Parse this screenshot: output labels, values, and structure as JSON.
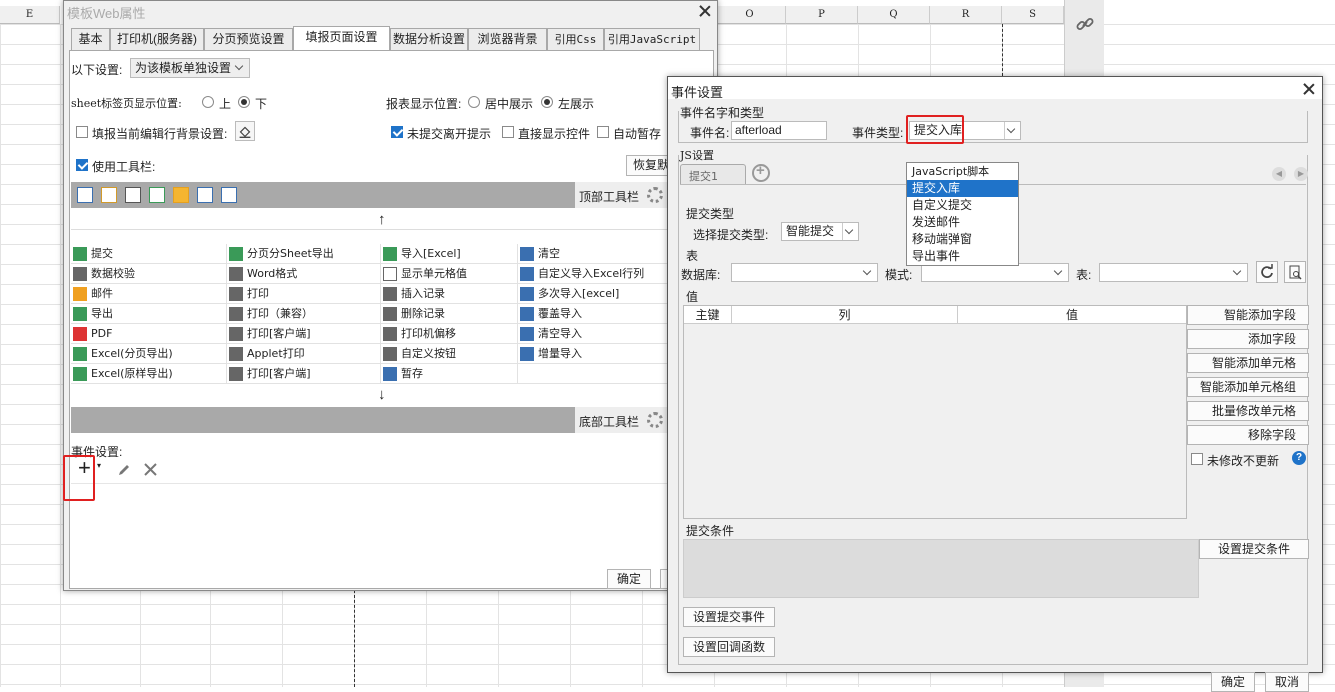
{
  "sheet": {
    "col_labels": [
      "E",
      "O",
      "P",
      "Q",
      "R",
      "S"
    ]
  },
  "web_dialog": {
    "title": "模板Web属性",
    "tabs": [
      "基本",
      "打印机(服务器)",
      "分页预览设置",
      "填报页面设置",
      "数据分析设置",
      "浏览器背景",
      "引用Css",
      "引用JavaScript"
    ],
    "scope_label": "以下设置:",
    "scope_value": "为该模板单独设置",
    "sheet_tab_pos_label": "sheet标签页显示位置:",
    "sheet_tab_up": "上",
    "sheet_tab_down": "下",
    "report_pos_label": "报表显示位置:",
    "report_center": "居中展示",
    "report_left": "左展示",
    "fill_bg_label": "填报当前编辑行背景设置:",
    "unsubmitted_label": "未提交离开提示",
    "direct_show_label": "直接显示控件",
    "auto_save_label": "自动暂存",
    "use_toolbar_label": "使用工具栏:",
    "restore_label": "恢复默",
    "top_toolbar_label": "顶部工具栏",
    "bottom_toolbar_label": "底部工具栏",
    "buttons": [
      [
        "提交",
        "分页分Sheet导出",
        "导入[Excel]",
        "清空"
      ],
      [
        "数据校验",
        "Word格式",
        "显示单元格值",
        "自定义导入Excel行列"
      ],
      [
        "邮件",
        "打印",
        "插入记录",
        "多次导入[excel]"
      ],
      [
        "导出",
        "打印（兼容）",
        "删除记录",
        "覆盖导入"
      ],
      [
        "PDF",
        "打印[客户端]",
        "打印机偏移",
        "清空导入"
      ],
      [
        "Excel(分页导出)",
        "Applet打印",
        "自定义按钮",
        "增量导入"
      ],
      [
        "Excel(原样导出)",
        "打印[客户端]",
        "暂存",
        ""
      ]
    ],
    "event_label": "事件设置:",
    "ok_label": "确定"
  },
  "event_dialog": {
    "title": "事件设置",
    "name_type_label": "事件名字和类型",
    "name_label": "事件名:",
    "name_value": "afterload",
    "type_label": "事件类型:",
    "type_value": "提交入库",
    "dropdown_options": [
      "JavaScript脚本",
      "提交入库",
      "自定义提交",
      "发送邮件",
      "移动端弹窗",
      "导出事件"
    ],
    "js_settings_label": "JS设置",
    "sub_tab": "提交1",
    "submit_type_section": "提交类型",
    "select_submit_type_label": "选择提交类型:",
    "select_submit_type_value": "智能提交",
    "table_section": "表",
    "database_label": "数据库:",
    "mode_label": "模式:",
    "table_label": "表:",
    "value_section": "值",
    "col_headers": [
      "主键",
      "列",
      "值"
    ],
    "side_buttons": [
      "智能添加字段",
      "添加字段",
      "智能添加单元格",
      "智能添加单元格组",
      "批量修改单元格",
      "移除字段"
    ],
    "no_update_label": "未修改不更新",
    "submit_cond_label": "提交条件",
    "set_submit_cond": "设置提交条件",
    "set_submit_event": "设置提交事件",
    "set_callback": "设置回调函数",
    "ok_label": "确定",
    "cancel_label": "取消"
  },
  "colors": {
    "accent": "#1f73c9",
    "highlight": "#e02020",
    "toolbar_bar": "#a9a9a9"
  }
}
